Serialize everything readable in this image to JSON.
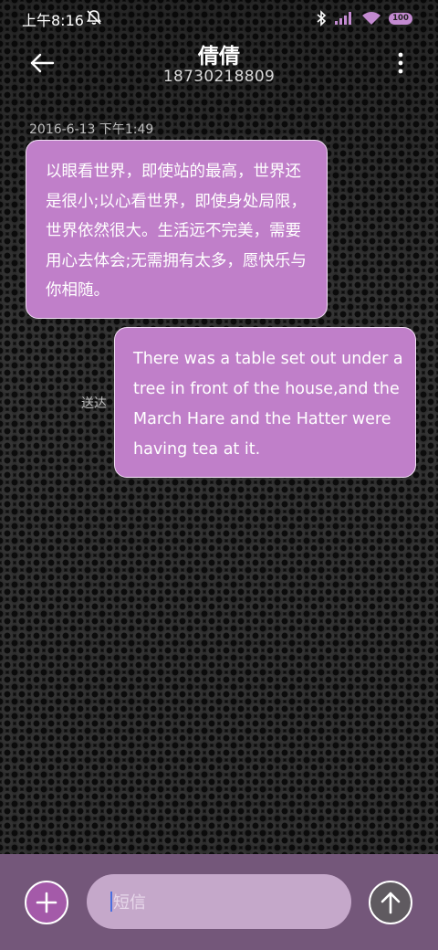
{
  "status_bar": {
    "time": "上午8:16",
    "mute_icon": "notifications-off-icon",
    "bluetooth_icon": "bluetooth-icon",
    "signal_icon": "signal-icon",
    "wifi_icon": "wifi-icon",
    "battery": "100"
  },
  "header": {
    "contact_name": "倩倩",
    "phone_number": "18730218809"
  },
  "messages": [
    {
      "timestamp": "2016-6-13 下午1:49",
      "direction": "incoming",
      "text": "以眼看世界，即使站的最高，世界还是很小;以心看世界，即使身处局限，世界依然很大。生活远不完美，需要用心去体会;无需拥有太多，愿快乐与你相随。"
    },
    {
      "direction": "outgoing",
      "status": "送达",
      "text": "There was a table set out under a tree in front of the house,and the March Hare and the Hatter were having tea at it."
    }
  ],
  "composer": {
    "placeholder": "短信",
    "add_icon": "plus-icon",
    "send_icon": "arrow-up-icon"
  },
  "colors": {
    "bubble": "#c07fc9",
    "composer_bg": "#74577a",
    "input_bg": "#c5a8ca",
    "add_button": "#a45aa9"
  }
}
